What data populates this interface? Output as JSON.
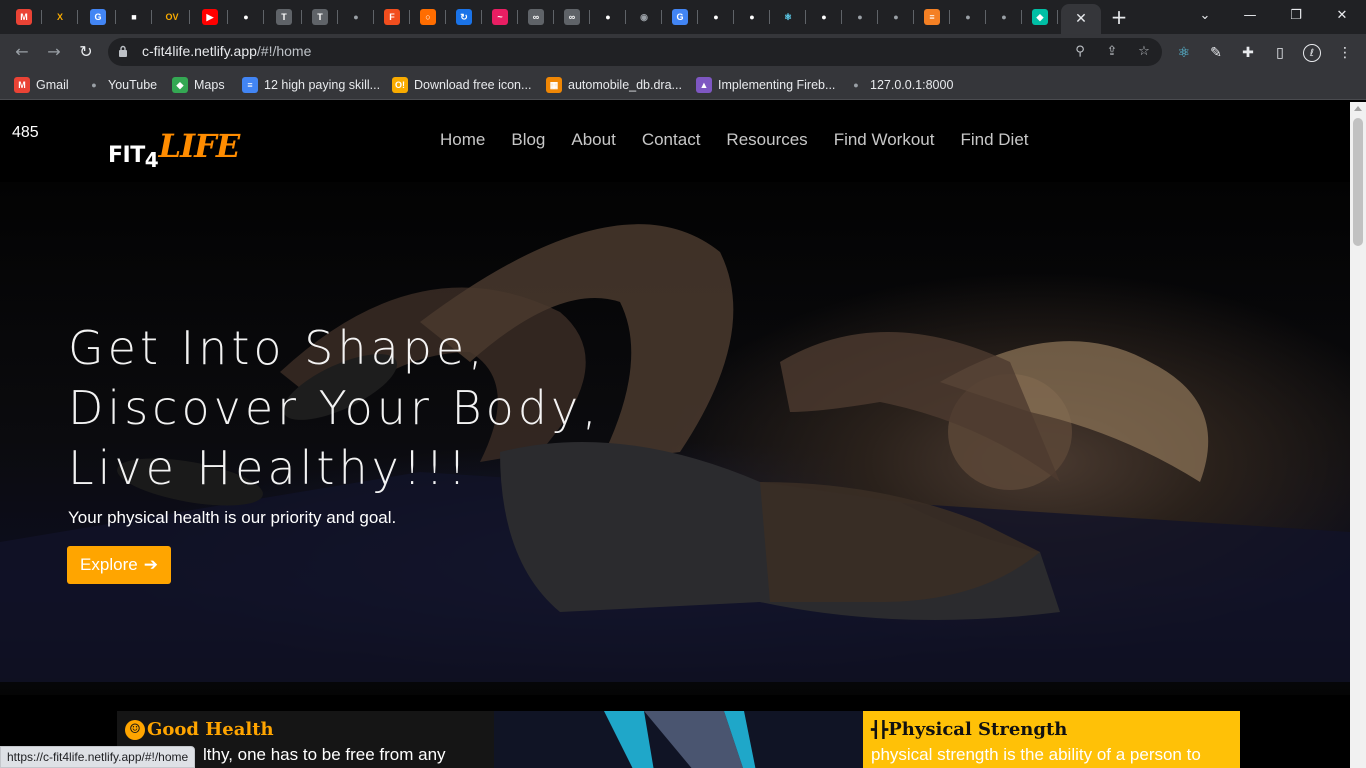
{
  "browser": {
    "tabs": [
      {
        "icon": "gmail-icon",
        "color": "#ea4335",
        "glyph": "M"
      },
      {
        "icon": "tools-icon",
        "color": "#f9ab00",
        "glyph": "X"
      },
      {
        "icon": "google-icon",
        "color": "#4285f4",
        "glyph": "G"
      },
      {
        "icon": "app-icon",
        "color": "#202124",
        "glyph": "■"
      },
      {
        "icon": "ov-icon",
        "color": "#f9ab00",
        "glyph": "OV"
      },
      {
        "icon": "youtube-icon",
        "color": "#ff0000",
        "glyph": "▶"
      },
      {
        "icon": "github-icon",
        "color": "#ffffff",
        "glyph": "●"
      },
      {
        "icon": "t-icon",
        "color": "#5f6368",
        "glyph": "T"
      },
      {
        "icon": "t-icon",
        "color": "#5f6368",
        "glyph": "T"
      },
      {
        "icon": "globe-icon",
        "color": "#9aa0a6",
        "glyph": "●"
      },
      {
        "icon": "figma-icon",
        "color": "#f24e1e",
        "glyph": "F"
      },
      {
        "icon": "ring-icon",
        "color": "#ff6d00",
        "glyph": "○"
      },
      {
        "icon": "arrow-loop-icon",
        "color": "#1a73e8",
        "glyph": "↻"
      },
      {
        "icon": "wave-icon",
        "color": "#e91e63",
        "glyph": "~"
      },
      {
        "icon": "loop-icon",
        "color": "#5f6368",
        "glyph": "∞"
      },
      {
        "icon": "loop-icon",
        "color": "#5f6368",
        "glyph": "∞"
      },
      {
        "icon": "github-icon",
        "color": "#ffffff",
        "glyph": "●"
      },
      {
        "icon": "eye-icon",
        "color": "#9aa0a6",
        "glyph": "◉"
      },
      {
        "icon": "google-icon",
        "color": "#4285f4",
        "glyph": "G"
      },
      {
        "icon": "github-icon",
        "color": "#ffffff",
        "glyph": "●"
      },
      {
        "icon": "github-icon",
        "color": "#ffffff",
        "glyph": "●"
      },
      {
        "icon": "react-icon",
        "color": "#61dafb",
        "glyph": "⚛"
      },
      {
        "icon": "github-icon",
        "color": "#ffffff",
        "glyph": "●"
      },
      {
        "icon": "globe-icon",
        "color": "#9aa0a6",
        "glyph": "●"
      },
      {
        "icon": "globe-icon",
        "color": "#9aa0a6",
        "glyph": "●"
      },
      {
        "icon": "stackoverflow-icon",
        "color": "#f48024",
        "glyph": "≡"
      },
      {
        "icon": "globe-icon",
        "color": "#9aa0a6",
        "glyph": "●"
      },
      {
        "icon": "globe-icon",
        "color": "#9aa0a6",
        "glyph": "●"
      },
      {
        "icon": "diamond-icon",
        "color": "#00bfa5",
        "glyph": "◆"
      }
    ],
    "active_tab_close": "✕",
    "new_tab": "+",
    "url_host": "c-fit4life.netlify.app",
    "url_path": "/#!/home",
    "bookmarks": [
      {
        "label": "Gmail",
        "icon": "gmail-icon",
        "color": "#ea4335",
        "glyph": "M"
      },
      {
        "label": "YouTube",
        "icon": "globe-icon",
        "color": "#9aa0a6",
        "glyph": "●"
      },
      {
        "label": "Maps",
        "icon": "maps-icon",
        "color": "#34a853",
        "glyph": "◆"
      },
      {
        "label": "12 high paying skill...",
        "icon": "docs-icon",
        "color": "#4285f4",
        "glyph": "≡"
      },
      {
        "label": "Download free icon...",
        "icon": "icon-site-icon",
        "color": "#f9ab00",
        "glyph": "O!"
      },
      {
        "label": "automobile_db.dra...",
        "icon": "drawio-icon",
        "color": "#f08705",
        "glyph": "▦"
      },
      {
        "label": "Implementing Fireb...",
        "icon": "rocket-icon",
        "color": "#7e57c2",
        "glyph": "▲"
      },
      {
        "label": "127.0.0.1:8000",
        "icon": "globe-icon",
        "color": "#9aa0a6",
        "glyph": "●"
      }
    ],
    "status_url": "https://c-fit4life.netlify.app/#!/home"
  },
  "page": {
    "counter": "485",
    "logo": {
      "fit": "FIT",
      "four": "4",
      "life": "LIFE"
    },
    "nav": [
      "Home",
      "Blog",
      "About",
      "Contact",
      "Resources",
      "Find Workout",
      "Find Diet"
    ],
    "hero": {
      "title_lines": [
        "Get Into Shape,",
        "Discover Your Body,",
        "Live Healthy!!!"
      ],
      "subtitle": "Your physical health is our priority and goal.",
      "cta_label": "Explore",
      "cta_arrow": "➔"
    },
    "cards": [
      {
        "title": "Good Health",
        "icon": "accessibility-icon",
        "glyph": "☺",
        "body": "lthy, one has to be free from any"
      },
      {
        "title": "Physical Strength",
        "icon": "dumbbell-icon",
        "glyph": "┫┣",
        "body": "physical strength is the ability of a person to"
      }
    ]
  },
  "colors": {
    "accent": "#ffa500",
    "card_yellow": "#ffc107",
    "chrome_dark": "#202124",
    "chrome_mid": "#35363a"
  }
}
